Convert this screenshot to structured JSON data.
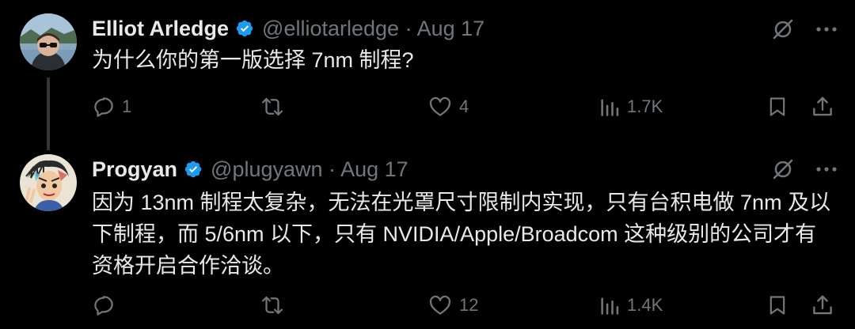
{
  "tweets": [
    {
      "name": "Elliot Arledge",
      "handle": "@elliotarledge",
      "separator": "·",
      "date": "Aug 17",
      "text": "为什么你的第一版选择 7nm 制程?",
      "replies": "1",
      "likes": "4",
      "views": "1.7K"
    },
    {
      "name": "Progyan",
      "handle": "@plugyawn",
      "separator": "·",
      "date": "Aug 17",
      "text": "因为 13nm 制程太复杂，无法在光罩尺寸限制内实现，只有台积电做 7nm 及以下制程，而 5/6nm 以下，只有 NVIDIA/Apple/Broadcom 这种级别的公司才有资格开启合作洽谈。",
      "likes": "12",
      "views": "1.4K"
    }
  ],
  "colors": {
    "background": "#000000",
    "text": "#e7e9ea",
    "muted": "#71767b",
    "verified": "#1d9bf0"
  },
  "icons": [
    "verified-badge-icon",
    "grok-icon",
    "more-icon",
    "reply-icon",
    "retweet-icon",
    "like-icon",
    "views-icon",
    "bookmark-icon",
    "share-icon"
  ]
}
